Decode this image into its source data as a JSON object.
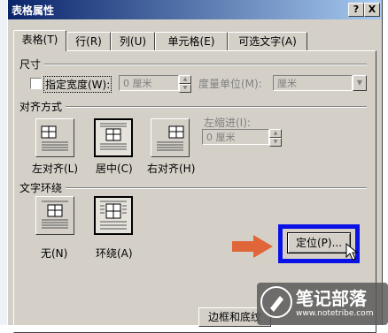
{
  "window": {
    "title": "表格属性",
    "help": "?",
    "close": "X"
  },
  "tabs": [
    {
      "label": "表格(T)"
    },
    {
      "label": "行(R)"
    },
    {
      "label": "列(U)"
    },
    {
      "label": "单元格(E)"
    },
    {
      "label": "可选文字(A)"
    }
  ],
  "size": {
    "section": "尺寸",
    "specify_width_label": "指定宽度(W):",
    "width_value": "0 厘米",
    "unit_label": "度量单位(M):",
    "unit_value": "厘米"
  },
  "alignment": {
    "section": "对齐方式",
    "left": "左对齐(L)",
    "center": "居中(C)",
    "right": "右对齐(H)",
    "indent_label": "左缩进(I):",
    "indent_value": "0 厘米"
  },
  "wrapping": {
    "section": "文字环绕",
    "none": "无(N)",
    "around": "环绕(A)"
  },
  "buttons": {
    "positioning": "定位(P)...",
    "borders": "边框和底纹"
  },
  "watermark": {
    "text": "笔记部落",
    "url": "www.notetribe.com"
  },
  "colors": {
    "highlight": "#0b12e6",
    "arrow": "#e0663a"
  }
}
